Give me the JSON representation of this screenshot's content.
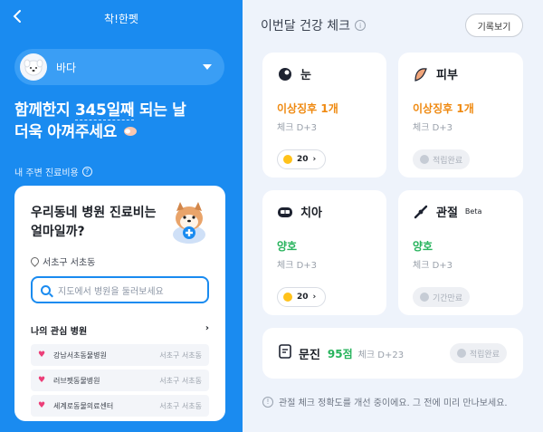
{
  "header": {
    "title": "착!한펫",
    "back_icon": "chevron-left-icon"
  },
  "pet": {
    "name": "바다"
  },
  "headline": {
    "line1_pre": "함께한지 ",
    "days": "345일째",
    "line1_post": " 되는 날",
    "line2": "더욱 아껴주세요"
  },
  "nearby": {
    "label": "내 주변 진료비용"
  },
  "hospital_card": {
    "question": "우리동네 병원 진료비는 얼마일까?",
    "location": "서초구 서초동",
    "search_placeholder": "지도에서 병원을 둘러보세요",
    "favorites_title": "나의 관심 병원",
    "favorites": [
      {
        "name": "강남서초동물병원",
        "addr": "서초구 서초동"
      },
      {
        "name": "러브펫동물병원",
        "addr": "서초구 서초동"
      },
      {
        "name": "세계로동물의료센터",
        "addr": "서초구 서초동"
      }
    ]
  },
  "health": {
    "title": "이번달 건강 체크",
    "history_button": "기록보기",
    "cards": [
      {
        "name": "눈",
        "icon": "eye-icon",
        "status": "이상징후 1개",
        "status_type": "warn",
        "check": "체크 D+3",
        "reward": "20",
        "reward_type": "coin"
      },
      {
        "name": "피부",
        "icon": "ear-icon",
        "status": "이상징후 1개",
        "status_type": "warn",
        "check": "체크 D+3",
        "reward": "적립완료",
        "reward_type": "done"
      },
      {
        "name": "치아",
        "icon": "teeth-icon",
        "status": "양호",
        "status_type": "good",
        "check": "체크 D+3",
        "reward": "20",
        "reward_type": "coin"
      },
      {
        "name": "관절",
        "badge": "Beta",
        "icon": "joint-icon",
        "status": "양호",
        "status_type": "good",
        "check": "체크 D+3",
        "reward": "기간만료",
        "reward_type": "done"
      }
    ],
    "survey": {
      "name": "문진",
      "score": "95점",
      "check": "체크 D+23",
      "reward": "적립완료"
    },
    "notice": "관절 체크 정확도를 개선 중이에요. 그 전에 미리 만나보세요."
  },
  "colors": {
    "primary": "#1a8bf0",
    "warn": "#ef8a12",
    "good": "#27b35c"
  }
}
